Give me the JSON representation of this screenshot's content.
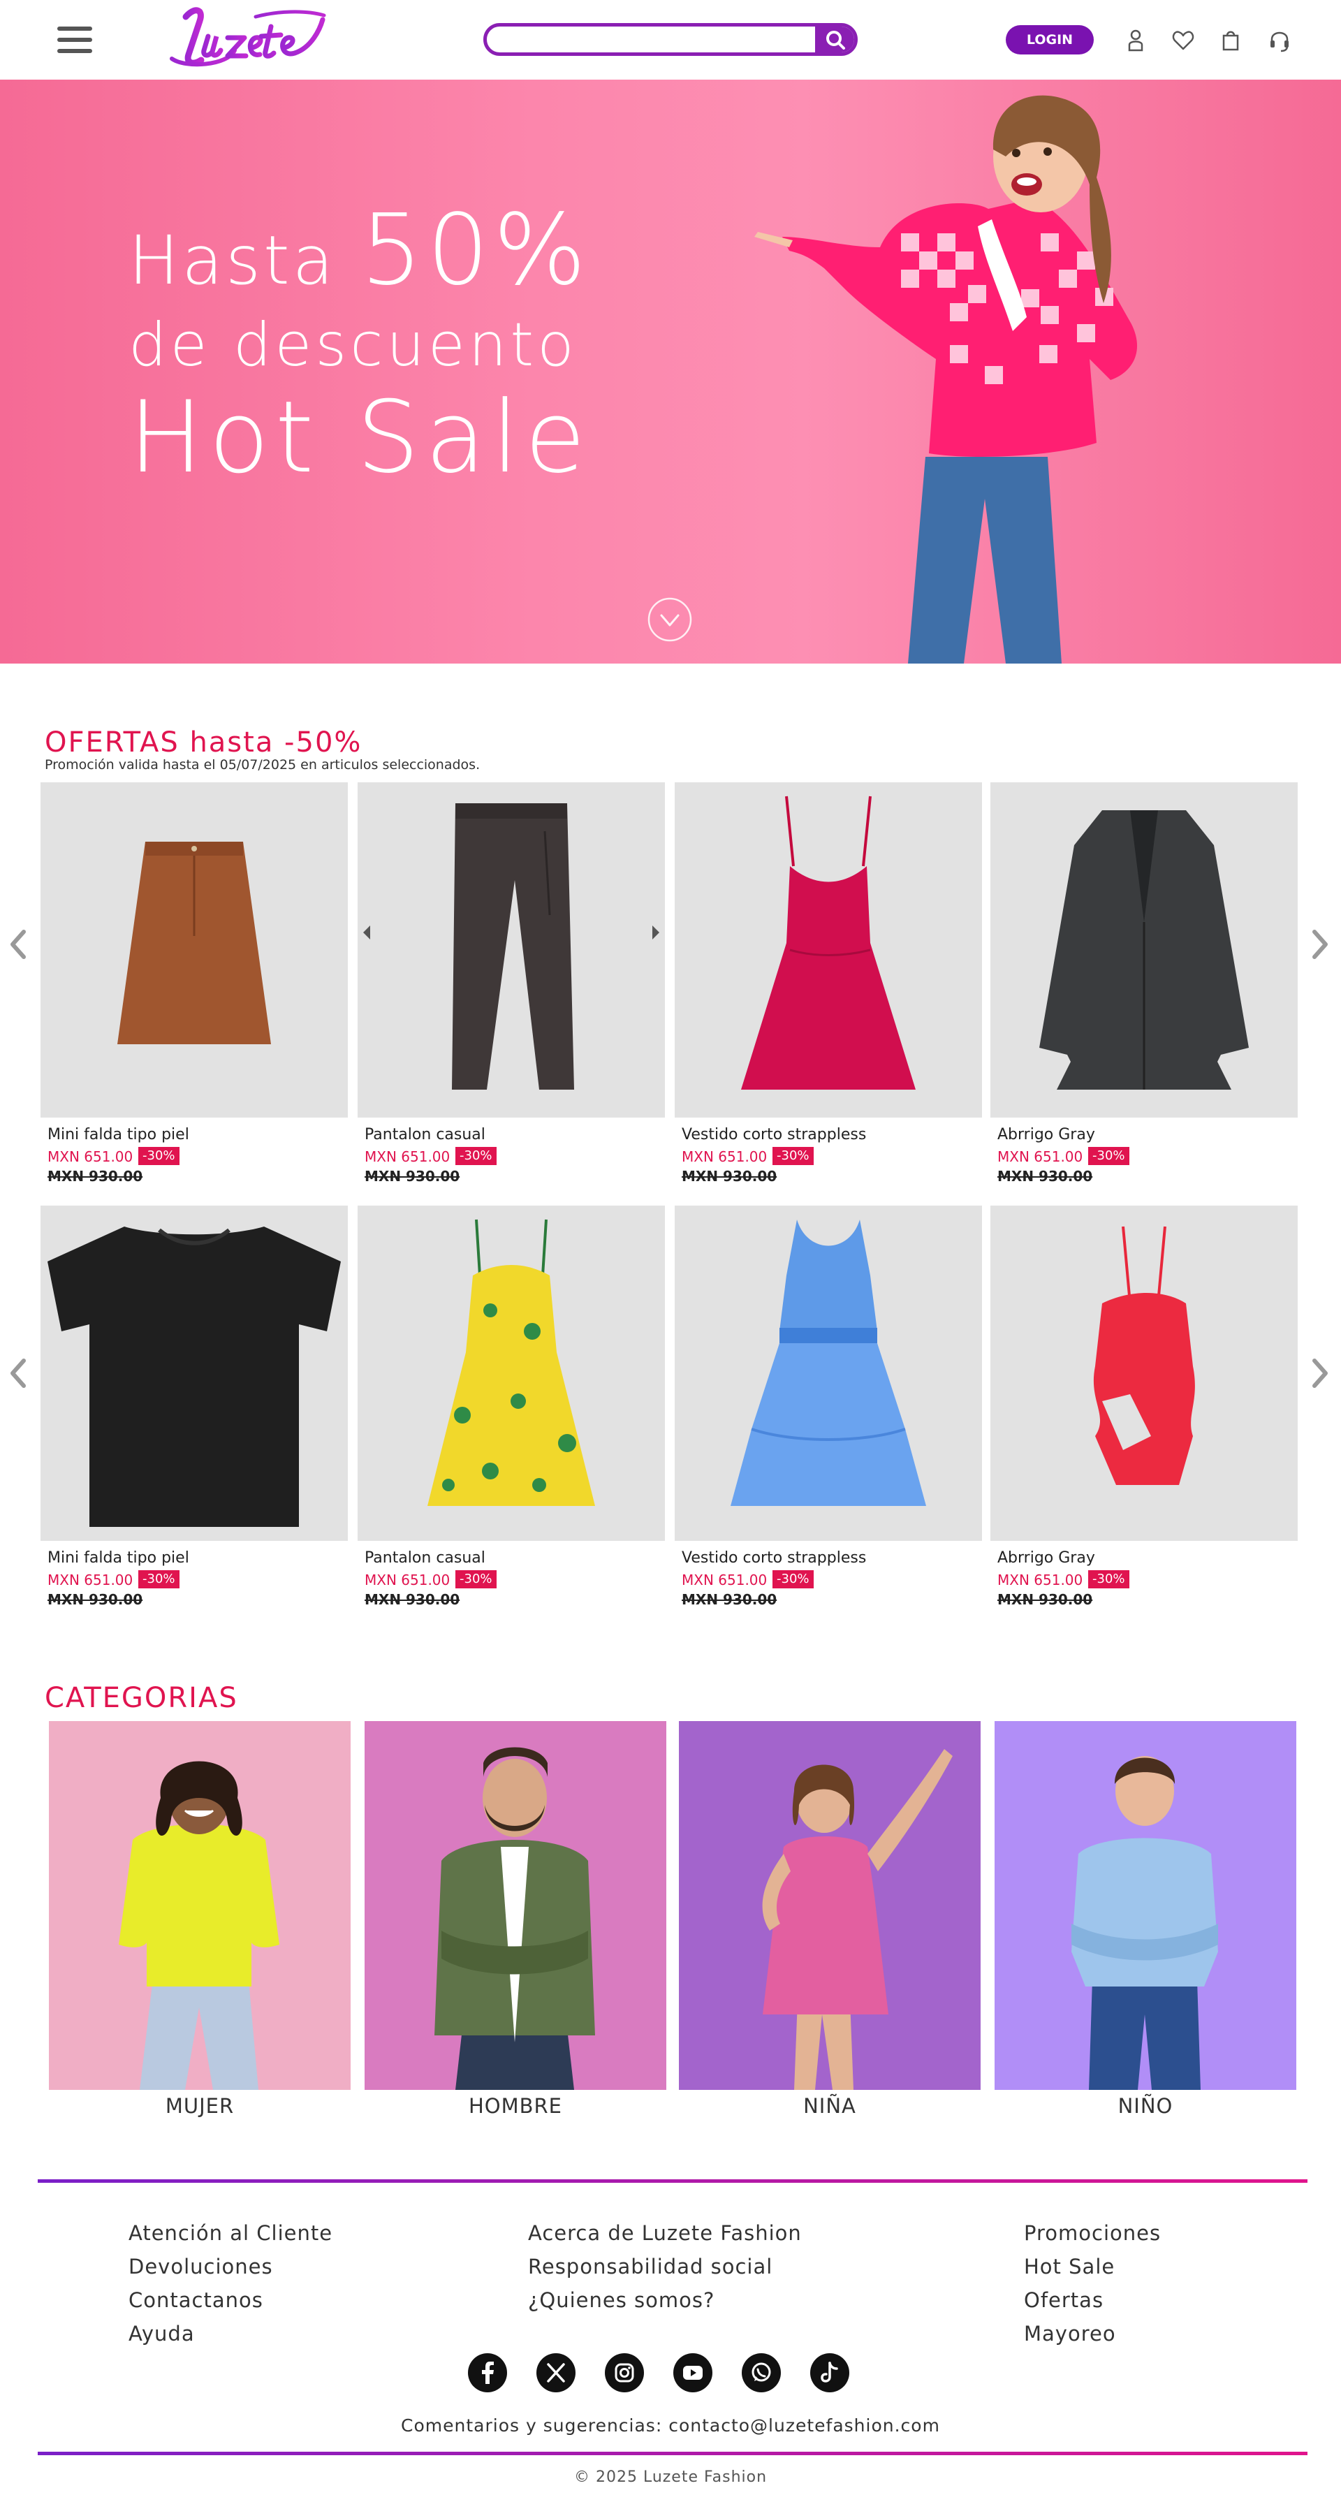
{
  "brand": {
    "name": "Luzete"
  },
  "header": {
    "search_placeholder": "",
    "login_label": "LOGIN",
    "icons": [
      "menu-icon",
      "search-icon",
      "user-icon",
      "heart-icon",
      "shopping-bag-icon",
      "headset-icon"
    ]
  },
  "hero": {
    "line1_prefix": "Hasta",
    "line1_value": "50%",
    "line2": "de descuento",
    "line3": "Hot Sale"
  },
  "offers": {
    "title": "OFERTAS hasta -50%",
    "note": "Promoción valida hasta el 05/07/2025 en articulos seleccionados.",
    "rows": [
      [
        {
          "name": "Mini falda tipo piel",
          "price": "MXN 651.00",
          "discount": "-30%",
          "old_price": "MXN 930.00",
          "item": "skirt"
        },
        {
          "name": "Pantalon casual",
          "price": "MXN 651.00",
          "discount": "-30%",
          "old_price": "MXN 930.00",
          "item": "pants"
        },
        {
          "name": "Vestido corto strappless",
          "price": "MXN 651.00",
          "discount": "-30%",
          "old_price": "MXN 930.00",
          "item": "dress-red"
        },
        {
          "name": "Abrrigo Gray",
          "price": "MXN 651.00",
          "discount": "-30%",
          "old_price": "MXN 930.00",
          "item": "coat"
        }
      ],
      [
        {
          "name": "Mini falda tipo piel",
          "price": "MXN 651.00",
          "discount": "-30%",
          "old_price": "MXN 930.00",
          "item": "tshirt"
        },
        {
          "name": "Pantalon casual",
          "price": "MXN 651.00",
          "discount": "-30%",
          "old_price": "MXN 930.00",
          "item": "dress-yellow"
        },
        {
          "name": "Vestido corto strappless",
          "price": "MXN 651.00",
          "discount": "-30%",
          "old_price": "MXN 930.00",
          "item": "dress-blue"
        },
        {
          "name": "Abrrigo Gray",
          "price": "MXN 651.00",
          "discount": "-30%",
          "old_price": "MXN 930.00",
          "item": "swimsuit"
        }
      ]
    ]
  },
  "categories": {
    "title": "CATEGORIAS",
    "items": [
      {
        "label": "MUJER",
        "bg": "#f0aec5"
      },
      {
        "label": "HOMBRE",
        "bg": "#d97bc0"
      },
      {
        "label": "NIÑA",
        "bg": "#a364cc"
      },
      {
        "label": "NIÑO",
        "bg": "#b18ef7"
      }
    ]
  },
  "footer": {
    "col1": [
      "Atención al Cliente",
      "Devoluciones",
      "Contactanos",
      "Ayuda"
    ],
    "col2": [
      "Acerca de Luzete Fashion",
      "Responsabilidad social",
      "¿Quienes somos?"
    ],
    "col3": [
      "Promociones",
      "Hot Sale",
      "Ofertas",
      "Mayoreo"
    ],
    "social": [
      "facebook-icon",
      "x-icon",
      "instagram-icon",
      "youtube-icon",
      "whatsapp-icon",
      "tiktok-icon"
    ],
    "feedback": "Comentarios y sugerencias: contacto@luzetefashion.com",
    "copyright": "© 2025 Luzete Fashion"
  },
  "colors": {
    "brand_purple": "#8a1fb3",
    "accent_pink": "#e0144f",
    "hero_pink": "#fc86ac"
  }
}
